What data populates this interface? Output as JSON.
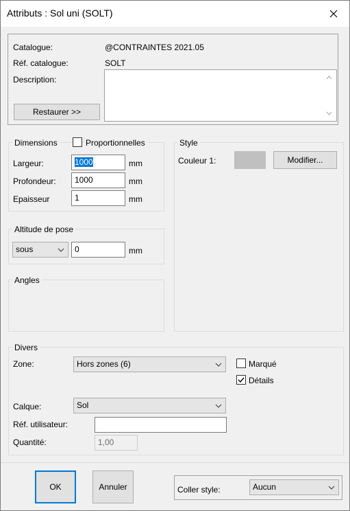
{
  "window": {
    "title": "Attributs : Sol uni (SOLT)"
  },
  "catalogue": {
    "catalogue_label": "Catalogue:",
    "catalogue_value": "@CONTRAINTES 2021.05",
    "ref_label": "Réf. catalogue:",
    "ref_value": "SOLT",
    "description_label": "Description:",
    "description_value": "",
    "restore_button": "Restaurer >>"
  },
  "dimensions": {
    "legend": "Dimensions",
    "proportional_label": "Proportionnelles",
    "proportional_checked": false,
    "width_label": "Largeur:",
    "width_value": "1000",
    "depth_label": "Profondeur:",
    "depth_value": "1000",
    "thickness_label": "Epaisseur",
    "thickness_value": "1",
    "unit": "mm"
  },
  "altitude": {
    "legend": "Altitude de pose",
    "mode_value": "sous",
    "value": "0",
    "unit": "mm"
  },
  "angles": {
    "legend": "Angles"
  },
  "style": {
    "legend": "Style",
    "color_label": "Couleur 1:",
    "color_swatch": "#c0c0c0",
    "modify_button": "Modifier..."
  },
  "divers": {
    "legend": "Divers",
    "zone_label": "Zone:",
    "zone_value": "Hors zones (6)",
    "marked_label": "Marqué",
    "marked_checked": false,
    "details_label": "Détails",
    "details_checked": true,
    "layer_label": "Calque:",
    "layer_value": "Sol",
    "user_ref_label": "Réf. utilisateur:",
    "user_ref_value": "",
    "quantity_label": "Quantité:",
    "quantity_value": "1,00"
  },
  "footer": {
    "ok_button": "OK",
    "cancel_button": "Annuler",
    "paste_style_label": "Coller style:",
    "paste_style_value": "Aucun"
  },
  "colors": {
    "accent": "#0078d7",
    "selection": "#0078d7",
    "dialog_bg": "#f0f0f0"
  }
}
